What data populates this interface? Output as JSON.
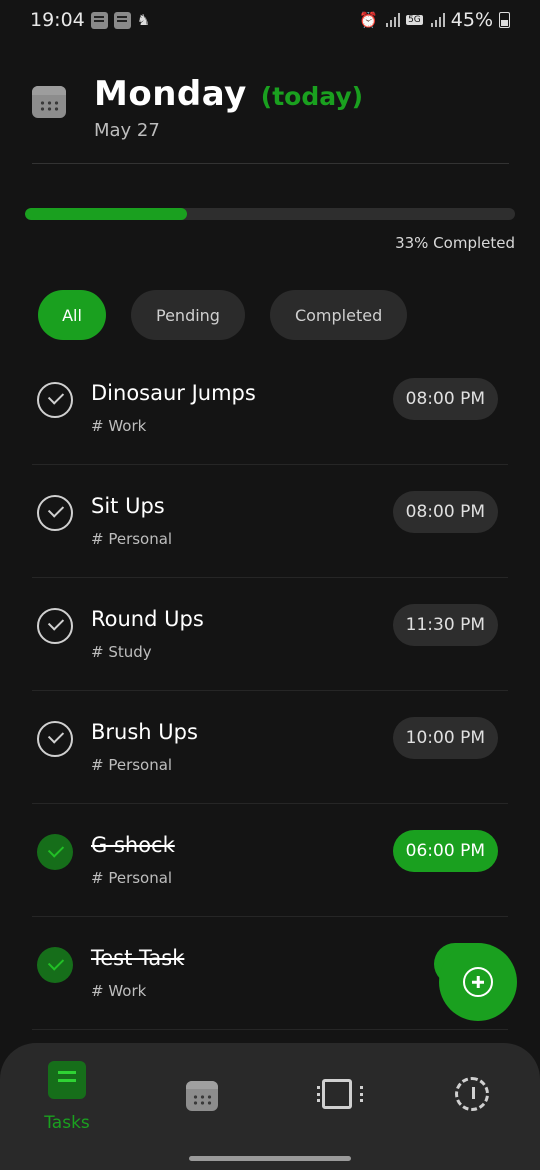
{
  "status_bar": {
    "time": "19:04",
    "battery": "45%",
    "network": "5G"
  },
  "header": {
    "day": "Monday",
    "today_label": "(today)",
    "date": "May 27"
  },
  "progress": {
    "fraction": 0.33,
    "label": "33% Completed"
  },
  "filters": {
    "all": "All",
    "pending": "Pending",
    "completed": "Completed",
    "selected": "All"
  },
  "tasks": [
    {
      "title": "Dinosaur Jumps",
      "tag": "# Work",
      "time": "08:00 PM",
      "completed": false
    },
    {
      "title": "Sit Ups",
      "tag": "# Personal",
      "time": "08:00 PM",
      "completed": false
    },
    {
      "title": "Round Ups",
      "tag": "# Study",
      "time": "11:30 PM",
      "completed": false
    },
    {
      "title": "Brush Ups",
      "tag": "# Personal",
      "time": "10:00 PM",
      "completed": false
    },
    {
      "title": "G shock",
      "tag": "# Personal",
      "time": "06:00 PM",
      "completed": true
    },
    {
      "title": "Test Task",
      "tag": "# Work",
      "time": "05:4",
      "completed": true
    }
  ],
  "bottom_nav": {
    "tasks_label": "Tasks",
    "active": "tasks"
  },
  "colors": {
    "accent": "#1aa01f",
    "background": "#141414",
    "surface": "#2b2b2b"
  },
  "icons": [
    "calendar-icon",
    "add-task-icon",
    "tasks-nav-icon",
    "calendar-nav-icon",
    "chip-nav-icon",
    "timer-nav-icon"
  ]
}
